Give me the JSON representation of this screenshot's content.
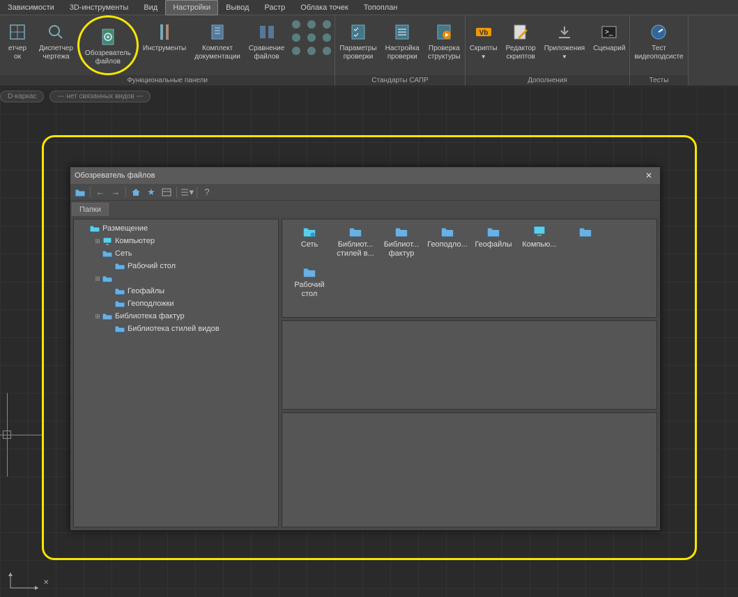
{
  "menu": {
    "items": [
      "Зависимости",
      "3D-инструменты",
      "Вид",
      "Настройки",
      "Вывод",
      "Растр",
      "Облака точек",
      "Топоплан"
    ],
    "active_index": 3
  },
  "ribbon": {
    "groups": [
      {
        "title": "Функциональные панели",
        "buttons": [
          {
            "label": "етчер\nок",
            "icon": "grid",
            "partial": true
          },
          {
            "label": "Диспетчер\nчертежа",
            "icon": "magnify"
          },
          {
            "label": "Обозреватель\nфайлов",
            "icon": "gear-doc",
            "highlighted": true
          },
          {
            "label": "Инструменты",
            "icon": "tools"
          },
          {
            "label": "Комплект\nдокументации",
            "icon": "book"
          },
          {
            "label": "Сравнение\nфайлов",
            "icon": "compare"
          }
        ],
        "small_icons": [
          [
            "ball",
            "ball",
            "sq"
          ],
          [
            "ab",
            "sun",
            "arr"
          ],
          [
            "ab2",
            "wp",
            "sq2"
          ]
        ]
      },
      {
        "title": "Стандарты САПР",
        "buttons": [
          {
            "label": "Параметры\nпроверки",
            "icon": "checklist"
          },
          {
            "label": "Настройка\nпроверки",
            "icon": "checklist2"
          },
          {
            "label": "Проверка\nструктуры",
            "icon": "checkplay"
          }
        ]
      },
      {
        "title": "Дополнения",
        "buttons": [
          {
            "label": "Скрипты",
            "icon": "vb",
            "drop": true
          },
          {
            "label": "Редактор\nскриптов",
            "icon": "edit"
          },
          {
            "label": "Приложения",
            "icon": "down",
            "drop": true
          },
          {
            "label": "Сценарий",
            "icon": "terminal"
          }
        ]
      },
      {
        "title": "Тесты",
        "buttons": [
          {
            "label": "Тест\nвидеоподсисте",
            "icon": "gauge"
          }
        ]
      }
    ]
  },
  "chips": [
    "D-каркас",
    "--- нет связанных видов ---"
  ],
  "dialog": {
    "title": "Обозреватель файлов",
    "tab": "Папки",
    "tree": [
      {
        "level": 0,
        "expander": "",
        "icon": "place",
        "label": "Размещение"
      },
      {
        "level": 1,
        "expander": "+",
        "icon": "computer",
        "label": "Компьютер"
      },
      {
        "level": 1,
        "expander": "",
        "icon": "folder",
        "label": "Сеть"
      },
      {
        "level": 2,
        "expander": "",
        "icon": "folder",
        "label": "Рабочий стол"
      },
      {
        "level": 1,
        "expander": "+",
        "icon": "folder",
        "label": ""
      },
      {
        "level": 2,
        "expander": "",
        "icon": "folder",
        "label": "Геофайлы"
      },
      {
        "level": 2,
        "expander": "",
        "icon": "folder",
        "label": "Геоподложки"
      },
      {
        "level": 1,
        "expander": "+",
        "icon": "folder",
        "label": "Библиотека фактур"
      },
      {
        "level": 2,
        "expander": "",
        "icon": "folder",
        "label": "Библиотека стилей видов"
      }
    ],
    "files_row1": [
      {
        "icon": "folder-net",
        "label": "Сеть"
      },
      {
        "icon": "folder",
        "label": "Библиот... стилей в..."
      },
      {
        "icon": "folder",
        "label": "Библиот... фактур"
      },
      {
        "icon": "folder",
        "label": "Геоподло..."
      },
      {
        "icon": "folder",
        "label": "Геофайлы"
      },
      {
        "icon": "computer",
        "label": "Компью..."
      },
      {
        "icon": "folder",
        "label": ""
      }
    ],
    "files_row2": [
      {
        "icon": "folder",
        "label": "Рабочий стол"
      }
    ]
  }
}
